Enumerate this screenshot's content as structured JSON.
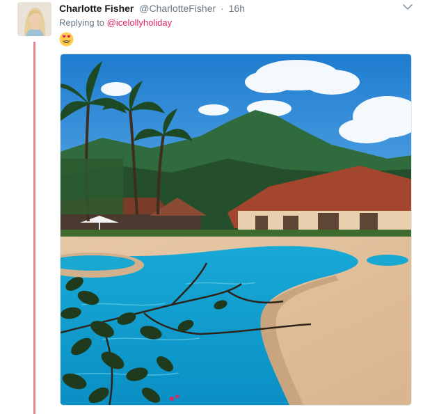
{
  "tweet": {
    "author_name": "Charlotte Fisher",
    "author_handle": "@CharlotteFisher",
    "separator": "·",
    "timestamp": "16h",
    "replying_prefix": "Replying to",
    "replying_to": "@icelollyholiday",
    "body_emoji": "😍",
    "media_description": "resort swimming pool with mountains and palm trees"
  },
  "icons": {
    "caret": "chevron-down-icon",
    "emoji": "heart-eyes-emoji-icon"
  },
  "colors": {
    "thread_line": "#e0848f",
    "mention": "#e0245e",
    "muted": "#657786"
  }
}
